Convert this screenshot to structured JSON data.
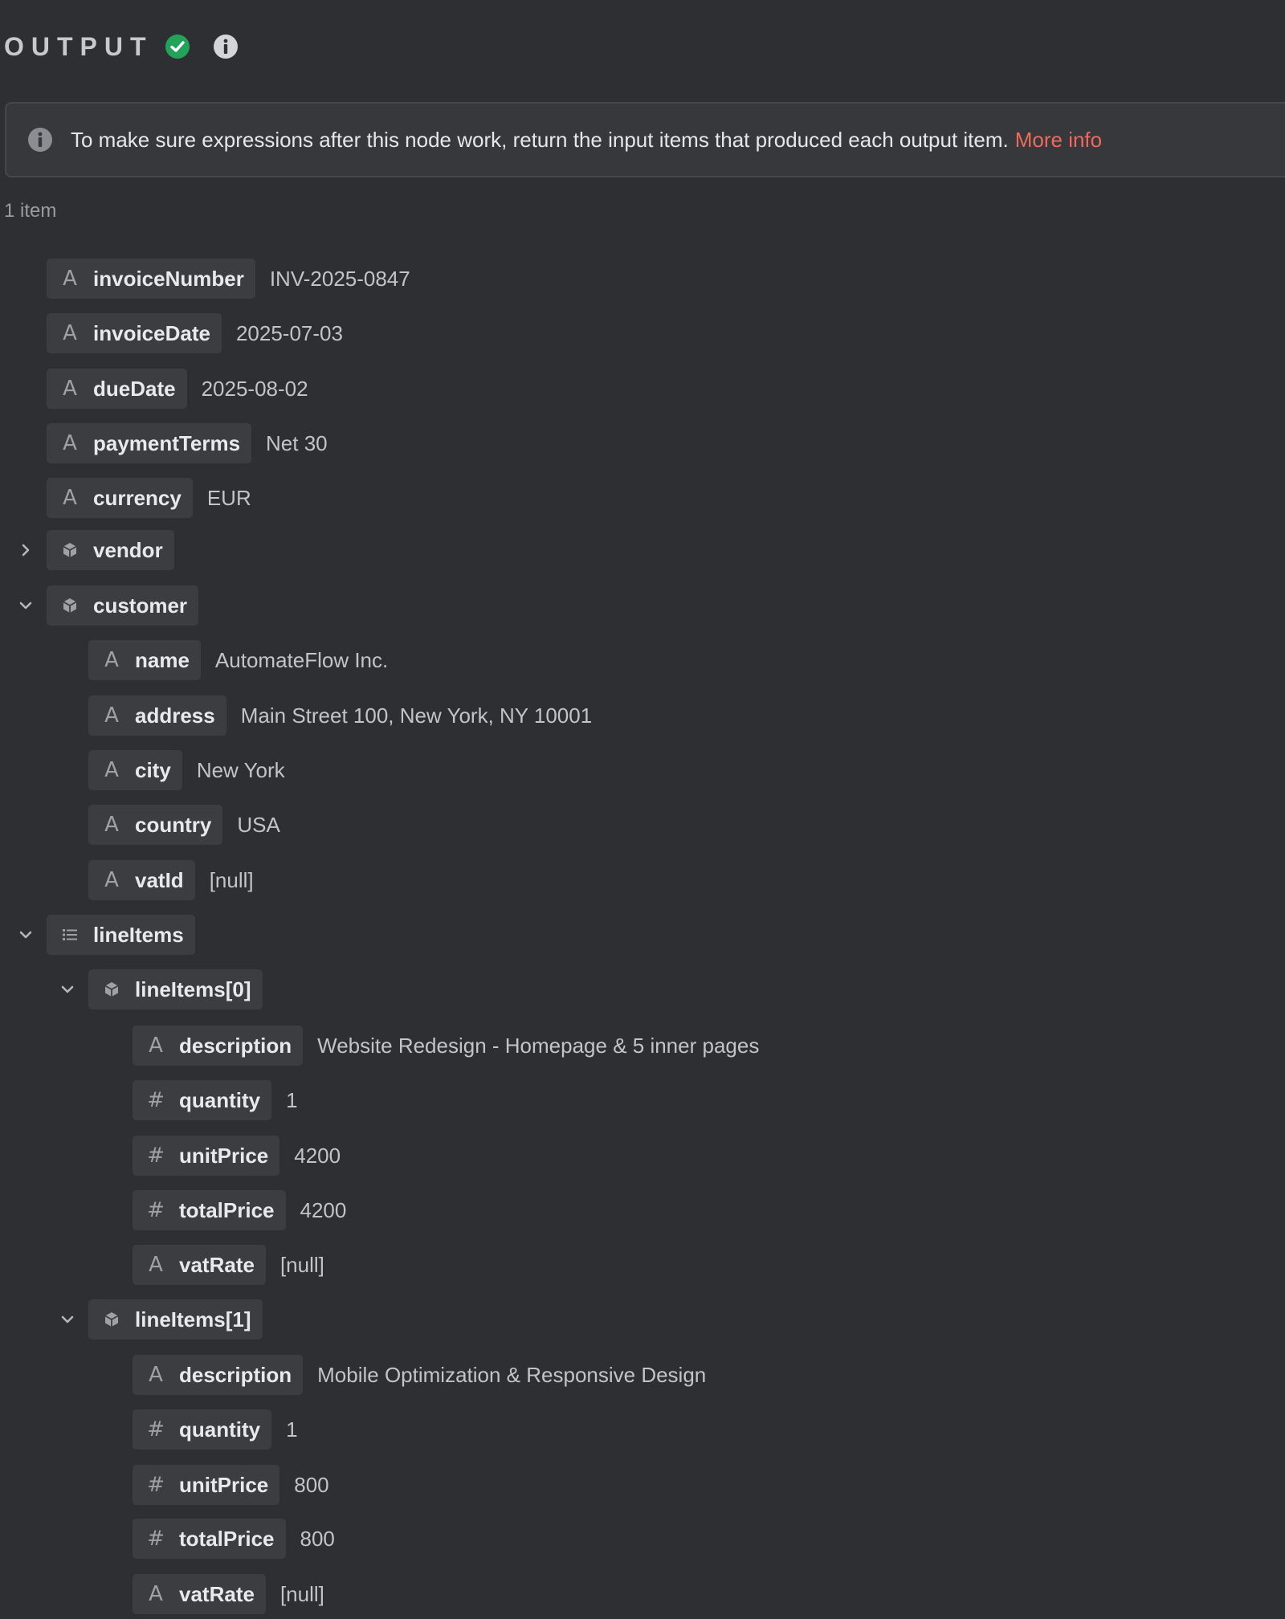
{
  "header": {
    "title": "OUTPUT"
  },
  "notice": {
    "text": "To make sure expressions after this node work, return the input items that produced each output item.",
    "link": "More info"
  },
  "item_count": "1 item",
  "fields": {
    "invoiceNumber": {
      "key": "invoiceNumber",
      "value": "INV-2025-0847"
    },
    "invoiceDate": {
      "key": "invoiceDate",
      "value": "2025-07-03"
    },
    "dueDate": {
      "key": "dueDate",
      "value": "2025-08-02"
    },
    "paymentTerms": {
      "key": "paymentTerms",
      "value": "Net 30"
    },
    "currency": {
      "key": "currency",
      "value": "EUR"
    },
    "vendor": {
      "key": "vendor"
    },
    "customer": {
      "key": "customer",
      "name": {
        "key": "name",
        "value": "AutomateFlow Inc."
      },
      "address": {
        "key": "address",
        "value": "Main Street 100, New York, NY 10001"
      },
      "city": {
        "key": "city",
        "value": "New York"
      },
      "country": {
        "key": "country",
        "value": "USA"
      },
      "vatId": {
        "key": "vatId",
        "value": "[null]"
      }
    },
    "lineItems": {
      "key": "lineItems",
      "items": [
        {
          "key": "lineItems[0]",
          "description": {
            "key": "description",
            "value": "Website Redesign - Homepage & 5 inner pages"
          },
          "quantity": {
            "key": "quantity",
            "value": "1"
          },
          "unitPrice": {
            "key": "unitPrice",
            "value": "4200"
          },
          "totalPrice": {
            "key": "totalPrice",
            "value": "4200"
          },
          "vatRate": {
            "key": "vatRate",
            "value": "[null]"
          }
        },
        {
          "key": "lineItems[1]",
          "description": {
            "key": "description",
            "value": "Mobile Optimization & Responsive Design"
          },
          "quantity": {
            "key": "quantity",
            "value": "1"
          },
          "unitPrice": {
            "key": "unitPrice",
            "value": "800"
          },
          "totalPrice": {
            "key": "totalPrice",
            "value": "800"
          },
          "vatRate": {
            "key": "vatRate",
            "value": "[null]"
          }
        }
      ]
    }
  },
  "icons": {
    "string": "A",
    "number": "#",
    "status_color": "#22a35a",
    "link_color": "#ef6a5a"
  }
}
